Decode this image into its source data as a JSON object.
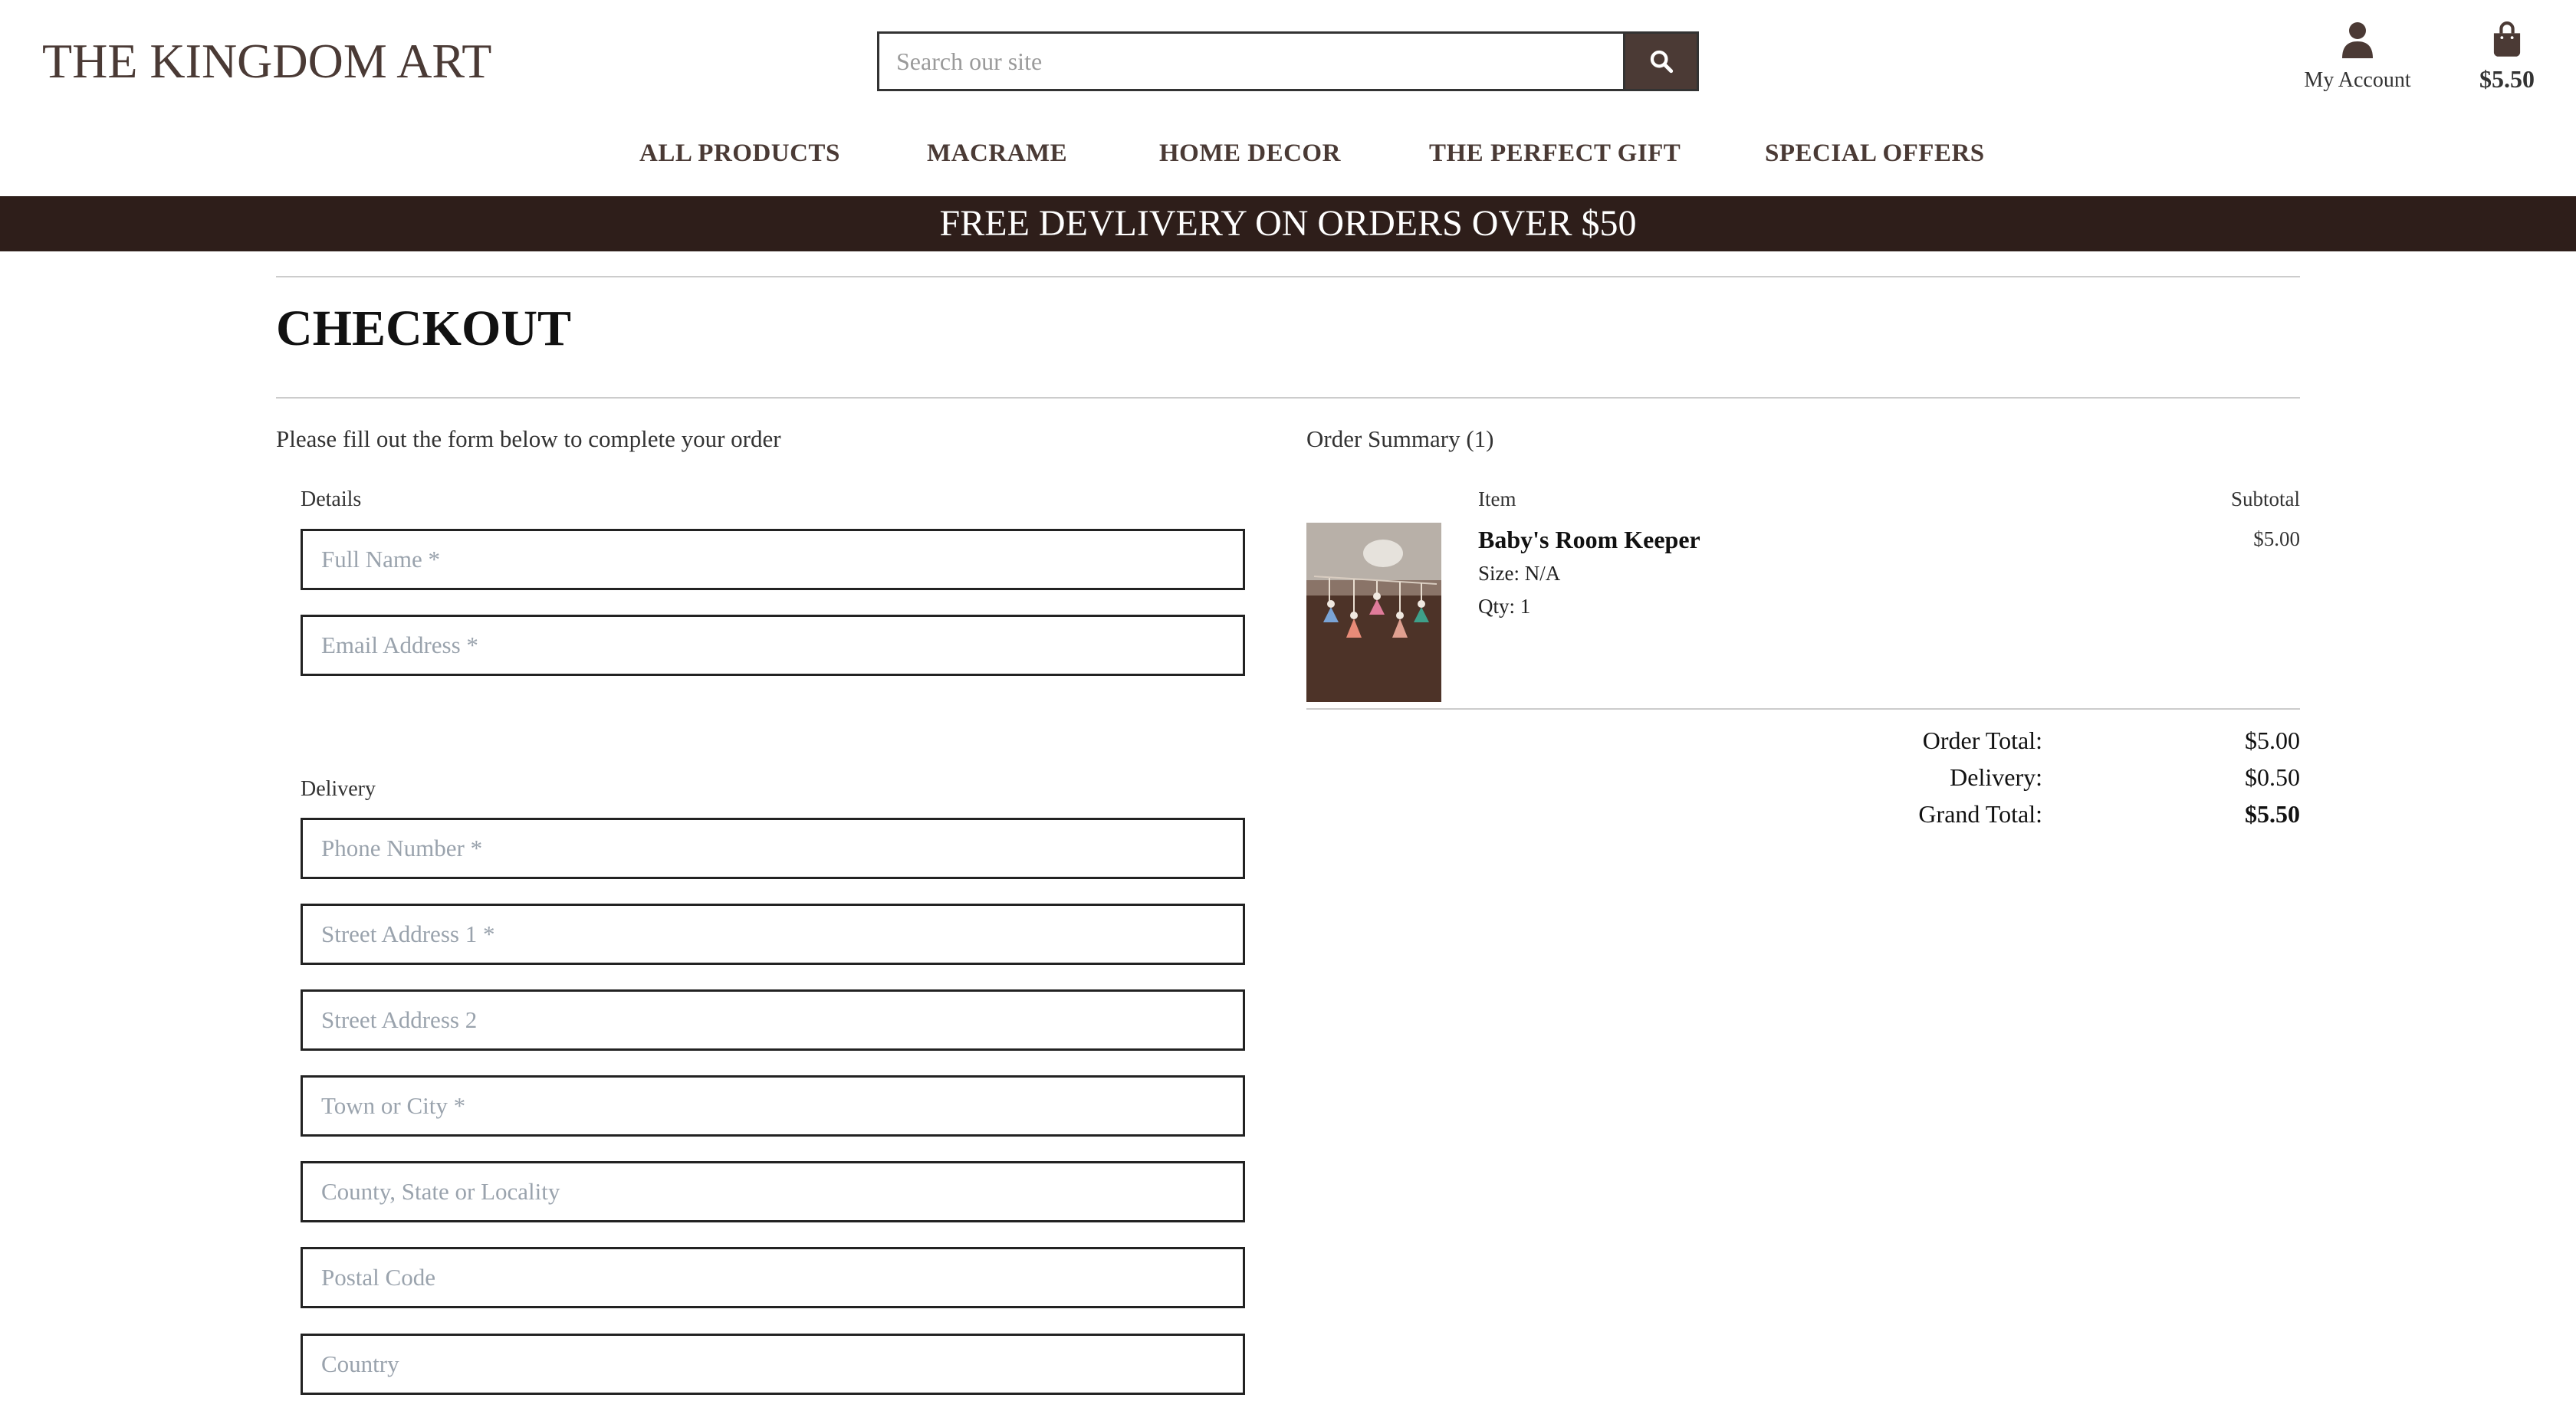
{
  "header": {
    "logo": "THE KINGDOM ART",
    "search_placeholder": "Search our site",
    "search_icon": "search-icon",
    "account_label": "My Account",
    "account_icon": "user-icon",
    "bag_icon": "shopping-bag-icon",
    "bag_total": "$5.50"
  },
  "nav": {
    "items": [
      "ALL PRODUCTS",
      "MACRAME",
      "HOME DECOR",
      "THE PERFECT GIFT",
      "SPECIAL OFFERS"
    ]
  },
  "banner": {
    "text": "FREE DEVLIVERY ON ORDERS OVER $50"
  },
  "page": {
    "title": "CHECKOUT"
  },
  "form": {
    "intro": "Please fill out the form below to complete your order",
    "details_label": "Details",
    "details_fields": [
      "Full Name *",
      "Email Address *"
    ],
    "delivery_label": "Delivery",
    "delivery_fields": [
      "Phone Number *",
      "Street Address 1 *",
      "Street Address 2",
      "Town or City *",
      "County, State or Locality",
      "Postal Code",
      "Country"
    ]
  },
  "summary": {
    "title": "Order Summary (1)",
    "item_header": "Item",
    "subtotal_header": "Subtotal",
    "item": {
      "name": "Baby's Room Keeper",
      "size": "Size: N/A",
      "qty": "Qty: 1",
      "subtotal": "$5.00"
    },
    "totals": {
      "order_total_label": "Order Total:",
      "order_total": "$5.00",
      "delivery_label": "Delivery:",
      "delivery": "$0.50",
      "grand_total_label": "Grand Total:",
      "grand_total": "$5.50"
    }
  },
  "colors": {
    "brand": "#4b3a35",
    "banner": "#2e1e1a",
    "placeholder": "#9aa3ad"
  }
}
